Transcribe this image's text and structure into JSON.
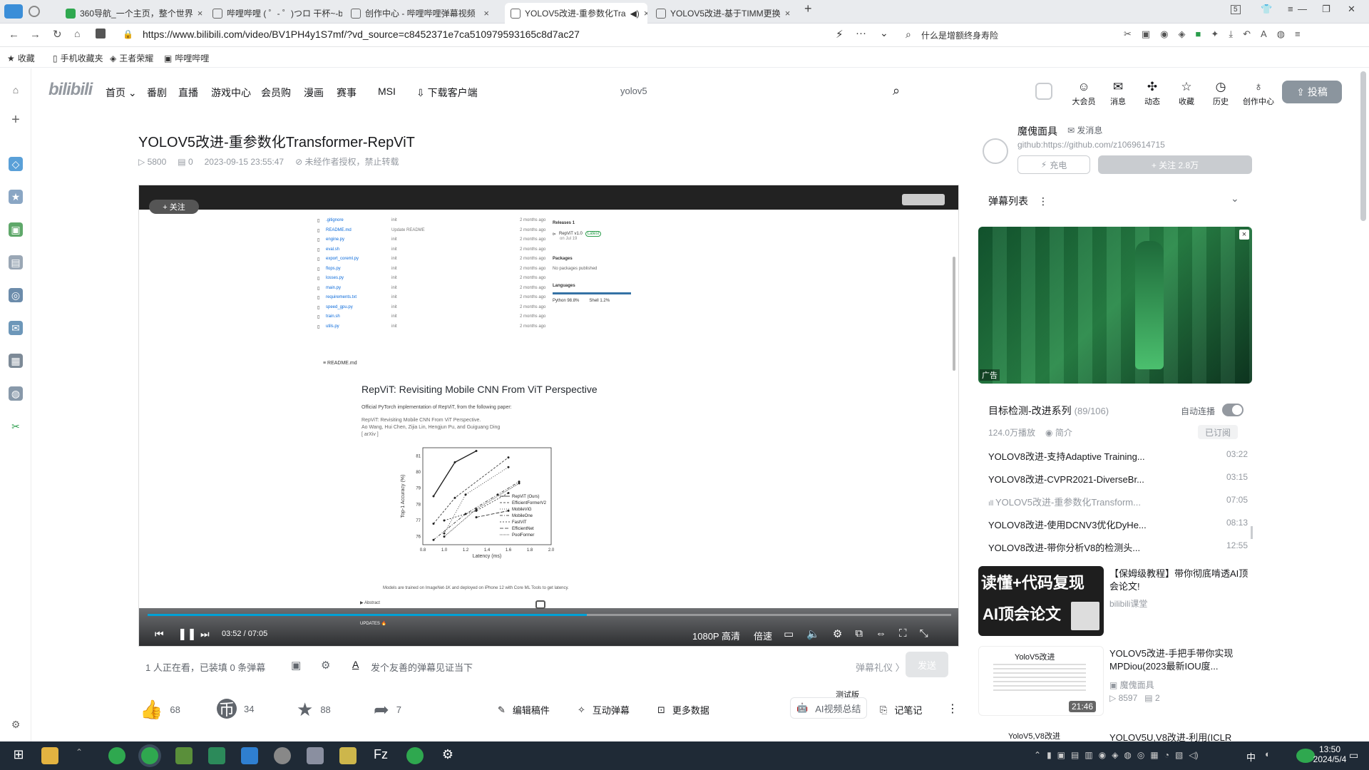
{
  "browser": {
    "tabs": [
      {
        "label": "360导航_一个主页，整个世界"
      },
      {
        "label": "哔哩哔哩 ( ゜- ゜)つロ 干杯~-b"
      },
      {
        "label": "创作中心 - 哔哩哔哩弹幕视频"
      },
      {
        "label": "YOLOV5改进-重参数化Tra"
      },
      {
        "label": "YOLOV5改进-基于TIMM更换"
      }
    ],
    "url": "https://www.bilibili.com/video/BV1PH4y1S7mf/?vd_source=c8452371e7ca510979593165c8d7ac27",
    "search_box": "什么是增额终身寿险",
    "bookmarks": [
      "收藏",
      "手机收藏夹",
      "王者荣耀",
      "哔哩哔哩"
    ],
    "tab_count": "5"
  },
  "header": {
    "logo": "bilibili",
    "nav": [
      "首页",
      "番剧",
      "直播",
      "游戏中心",
      "会员购",
      "漫画",
      "赛事",
      "MSI",
      "下载客户端"
    ],
    "search_placeholder": "yolov5",
    "icons": [
      "大会员",
      "消息",
      "动态",
      "收藏",
      "历史",
      "创作中心"
    ],
    "upload_label": "投稿"
  },
  "video": {
    "title": "YOLOV5改进-重参数化Transformer-RepViT",
    "plays": "5800",
    "danmaku": "0",
    "date": "2023-09-15 23:55:47",
    "copyright": "未经作者授权，禁止转载",
    "follow_label": "+ 关注",
    "player": {
      "time": "03:52 / 07:05",
      "quality": "1080P 高清",
      "speed": "倍速",
      "progress": 0.547
    },
    "content": {
      "files": [
        ".gitignore",
        "README.md",
        "engine.py",
        "eval.sh",
        "export_coreml.py",
        "flops.py",
        "losses.py",
        "main.py",
        "requirements.txt",
        "speed_gpu.py",
        "train.sh",
        "utils.py"
      ],
      "file_msgs": [
        "init",
        "Update README",
        "init",
        "init",
        "init",
        "init",
        "init",
        "init",
        "init",
        "init",
        "init",
        "init"
      ],
      "file_times": [
        "2 months ago",
        "2 months ago",
        "2 months ago",
        "2 months ago",
        "2 months ago",
        "2 months ago",
        "2 months ago",
        "2 months ago",
        "2 months ago",
        "2 months ago",
        "2 months ago",
        "2 months ago"
      ],
      "readme_label": "README.md",
      "releases": "Releases 1",
      "release_item": "RepViT v1.0",
      "latest": "Latest",
      "release_date": "on Jul 19",
      "packages": "Packages",
      "packages_note": "No packages published",
      "languages": "Languages",
      "lang1": "Python 98.8%",
      "lang2": "Shell 1.2%",
      "paper_title": "RepViT: Revisiting Mobile CNN From ViT Perspective",
      "paper_desc": "Official PyTorch implementation of RepViT, from the following paper:",
      "paper_ref": "RepViT: Revisiting Mobile CNN From ViT Perspective.",
      "paper_authors": "Ao Wang, Hui Chen, Zijia Lin, Hengjun Pu, and Guiguang Ding",
      "paper_arxiv": "[ arXiv ]",
      "chart_caption": "Models are trained on ImageNet-1K and deployed on iPhone 12 with Core ML Tools to get latency.",
      "abstract_label": "▶ Abstract",
      "updates_label": "UPDATES 🔥"
    }
  },
  "chart_data": {
    "type": "line",
    "xlabel": "Latency (ms)",
    "ylabel": "Top-1 Accuracy (%)",
    "xlim": [
      0.8,
      2.0
    ],
    "ylim": [
      75.5,
      81.5
    ],
    "xticks": [
      "0.8",
      "1.0",
      "1.2",
      "1.4",
      "1.6",
      "1.8",
      "2.0"
    ],
    "yticks": [
      "76",
      "77",
      "78",
      "79",
      "80",
      "81"
    ],
    "series": [
      {
        "name": "RepViT (Ours)",
        "x": [
          0.9,
          1.1,
          1.3
        ],
        "y": [
          78.5,
          80.6,
          81.3
        ]
      },
      {
        "name": "EfficientFormerV2",
        "x": [
          0.9,
          1.1,
          1.6
        ],
        "y": [
          76.8,
          78.4,
          80.9
        ]
      },
      {
        "name": "MobileViG",
        "x": [
          1.0,
          1.2,
          1.6
        ],
        "y": [
          76.2,
          78.6,
          80.3
        ]
      },
      {
        "name": "MobileOne",
        "x": [
          0.9,
          1.2,
          1.5,
          1.7
        ],
        "y": [
          75.8,
          77.4,
          78.6,
          79.4
        ]
      },
      {
        "name": "FastViT",
        "x": [
          1.0,
          1.3,
          1.6
        ],
        "y": [
          77.0,
          77.6,
          78.7
        ]
      },
      {
        "name": "EfficientNet",
        "x": [
          1.3,
          1.6
        ],
        "y": [
          77.2,
          77.6
        ]
      },
      {
        "name": "PoolFormer",
        "x": [
          1.0,
          1.3,
          1.7
        ],
        "y": [
          76.0,
          77.7,
          79.3
        ]
      }
    ]
  },
  "dm_bar": {
    "watching": "1 人正在看，已装填 0 条弹幕",
    "input_placeholder": "发个友善的弹幕见证当下",
    "etiquette": "弹幕礼仪 〉",
    "send": "发送"
  },
  "actions": {
    "like": "68",
    "coin": "34",
    "fav": "88",
    "share": "7",
    "edit": "编辑稿件",
    "interact": "互动弹幕",
    "data": "更多数据",
    "ai_tag": "测试版",
    "ai": "AI视频总结",
    "notes": "记笔记"
  },
  "up": {
    "name": "魔傀面具",
    "message": "发消息",
    "desc": "github:https://github.com/z1069614715",
    "charge": "充电",
    "follow": "+ 关注 2.8万"
  },
  "dm_list": {
    "title": "弹幕列表"
  },
  "ad": {
    "tag": "广告"
  },
  "playlist": {
    "title": "目标检测-改进系列",
    "count": "(89/106)",
    "autoplay": "自动连播",
    "plays": "124.0万播放",
    "intro": "简介",
    "subscribed": "已订阅",
    "items": [
      {
        "title": "YOLOV8改进-支持Adaptive Training...",
        "dur": "03:22"
      },
      {
        "title": "YOLOV8改进-CVPR2021-DiverseBr...",
        "dur": "03:15"
      },
      {
        "title": "YOLOV5改进-重参数化Transform...",
        "dur": "07:05"
      },
      {
        "title": "YOLOV8改进-使用DCNV3优化DyHe...",
        "dur": "08:13"
      },
      {
        "title": "YOLOV8改进-带你分析V8的检测头...",
        "dur": "12:55"
      }
    ]
  },
  "recs": [
    {
      "title": "【保姆级教程】带你彻底啃透AI顶会论文!",
      "author": "bilibili课堂",
      "thumb1": "读懂+代码复现",
      "thumb2": "AI顶会论文"
    },
    {
      "title": "YOLOV5改进-手把手带你实现MPDiou(2023最新IOU度...",
      "author": "魔傀面具",
      "plays": "8597",
      "dm": "2",
      "dur": "21:46",
      "thumb1": "YoloV5改进"
    },
    {
      "title": "YOLOV5U,V8改进-利用(ICLR",
      "thumb1": "YoloV5,V8改进"
    }
  ],
  "taskbar": {
    "time": "13:50",
    "date": "2024/5/4",
    "ime": "中"
  }
}
